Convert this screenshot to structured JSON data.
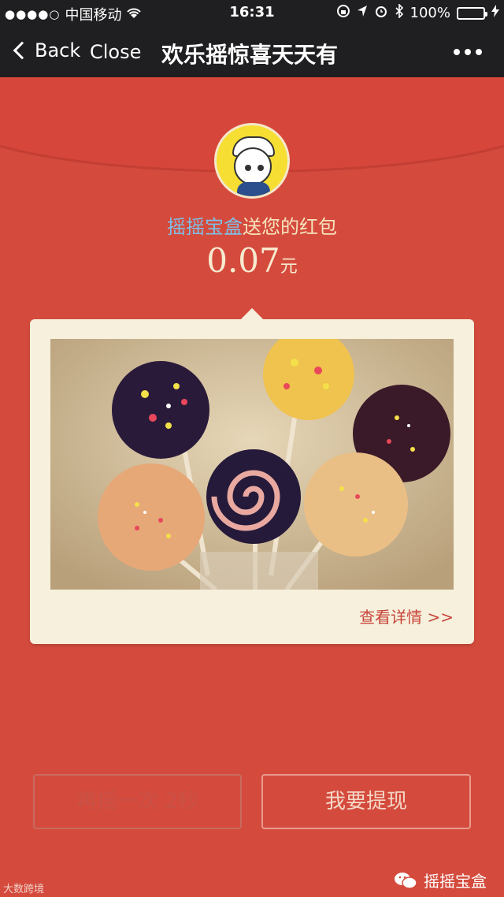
{
  "status": {
    "carrier": "中国移动",
    "time": "16:31",
    "battery": "100%",
    "battery_level": 1.0
  },
  "nav": {
    "back_label": "Back",
    "close_label": "Close",
    "title": "欢乐摇惊喜天天有"
  },
  "redpacket": {
    "sender_name": "摇摇宝盒",
    "sender_suffix": "送您的红包",
    "amount": "0.07",
    "unit": "元"
  },
  "card": {
    "details_link": "查看详情 >>"
  },
  "buttons": {
    "again": "再摇一次 2秒",
    "withdraw": "我要提现"
  },
  "footer": {
    "left_text": "大数跨境",
    "right_text": "摇摇宝盒"
  },
  "colors": {
    "background": "#d44b3d",
    "accent_name": "#7ec0e8",
    "link": "#c8443a"
  }
}
